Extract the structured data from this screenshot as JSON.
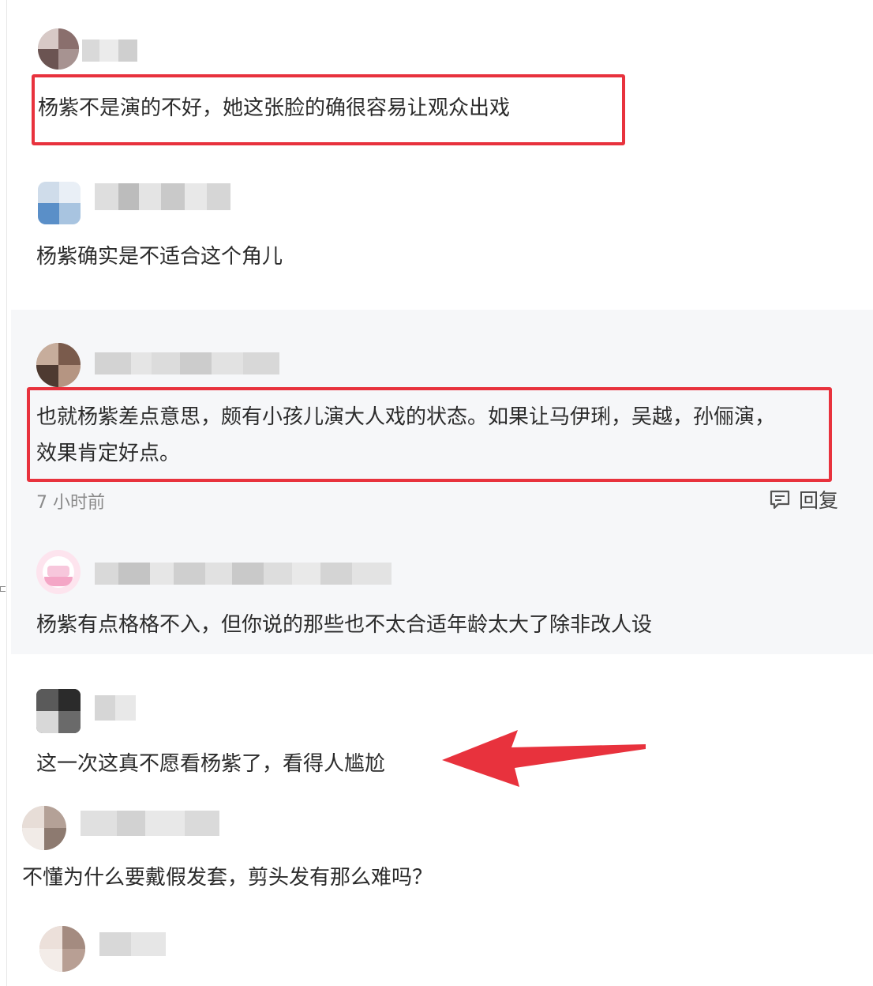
{
  "comments": [
    {
      "text": "杨紫不是演的不好，她这张脸的确很容易让观众出戏",
      "highlighted": true
    },
    {
      "text": "杨紫确实是不适合这个角儿",
      "highlighted": false
    },
    {
      "text_line1": "也就杨紫差点意思，颇有小孩儿演大人戏的状态。如果让马伊琍，吴越，孙俪演，",
      "text_line2": "效果肯定好点。",
      "highlighted": true,
      "time": "7 小时前",
      "reply_label": "回复"
    },
    {
      "text": "杨紫有点格格不入，但你说的那些也不太合适年龄太大了除非改人设",
      "highlighted": false
    },
    {
      "text": "这一次这真不愿看杨紫了，看得人尴尬",
      "highlighted": false,
      "pointed_by_arrow": true
    },
    {
      "text": "不懂为什么要戴假发套，剪头发有那么难吗？",
      "highlighted": false
    }
  ],
  "colors": {
    "highlight": "#e8323d",
    "arrow": "#e8323d",
    "reply_bg": "#f6f7f9",
    "text": "#2b2b2b",
    "meta": "#8a8a8a"
  },
  "icons": {
    "reply": "comment-bubble-icon"
  }
}
